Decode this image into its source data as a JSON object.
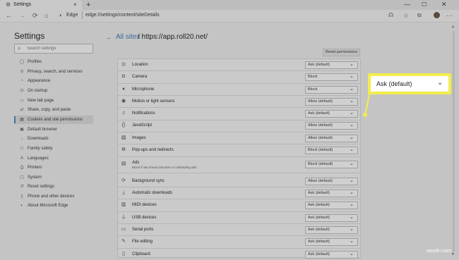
{
  "tab": {
    "title": "Settings",
    "favicon": "gear-icon",
    "new_tab": "+"
  },
  "window": {
    "minimize": "—",
    "maximize": "☐",
    "close": "✕"
  },
  "toolbar": {
    "back": "←",
    "forward": "→",
    "refresh": "C",
    "home": "⌂",
    "browser_label": "Edge",
    "url": "edge://settings/content/siteDetails"
  },
  "sidebar": {
    "title": "Settings",
    "search_placeholder": "Search settings",
    "items": [
      {
        "label": "Profiles",
        "icon": "person-icon",
        "glyph": "◯"
      },
      {
        "label": "Privacy, search, and services",
        "icon": "lock-icon",
        "glyph": "⊙"
      },
      {
        "label": "Appearance",
        "icon": "palette-icon",
        "glyph": "◔"
      },
      {
        "label": "On startup",
        "icon": "power-icon",
        "glyph": "⏻"
      },
      {
        "label": "New tab page",
        "icon": "tab-icon",
        "glyph": "▭"
      },
      {
        "label": "Share, copy, and paste",
        "icon": "share-icon",
        "glyph": "⇄"
      },
      {
        "label": "Cookies and site permissions",
        "icon": "cookie-icon",
        "glyph": "▦"
      },
      {
        "label": "Default browser",
        "icon": "browser-icon",
        "glyph": "▣"
      },
      {
        "label": "Downloads",
        "icon": "download-icon",
        "glyph": "↓"
      },
      {
        "label": "Family safety",
        "icon": "family-icon",
        "glyph": "⚇"
      },
      {
        "label": "Languages",
        "icon": "language-icon",
        "glyph": "A"
      },
      {
        "label": "Printers",
        "icon": "printer-icon",
        "glyph": "⎙"
      },
      {
        "label": "System",
        "icon": "system-icon",
        "glyph": "▢"
      },
      {
        "label": "Reset settings",
        "icon": "reset-icon",
        "glyph": "↺"
      },
      {
        "label": "Phone and other devices",
        "icon": "phone-icon",
        "glyph": "▯"
      },
      {
        "label": "About Microsoft Edge",
        "icon": "edge-icon",
        "glyph": "◐"
      }
    ],
    "active_index": 6
  },
  "main": {
    "back_arrow": "←",
    "breadcrumb_link": "All sites",
    "breadcrumb_rest": "/ https://app.roll20.net/",
    "reset_button": "Reset permissions",
    "permissions": [
      {
        "label": "Location",
        "value": "Ask (default)",
        "icon": "location-icon",
        "glyph": "◎"
      },
      {
        "label": "Camera",
        "value": "Block",
        "icon": "camera-icon",
        "glyph": "◘"
      },
      {
        "label": "Microphone",
        "value": "Block",
        "icon": "microphone-icon",
        "glyph": "♦"
      },
      {
        "label": "Motion or light sensors",
        "value": "Allow (default)",
        "icon": "sensor-icon",
        "glyph": "◉"
      },
      {
        "label": "Notifications",
        "value": "Ask (default)",
        "icon": "bell-icon",
        "glyph": "♫"
      },
      {
        "label": "JavaScript",
        "value": "Allow (default)",
        "icon": "javascript-icon",
        "glyph": "{}"
      },
      {
        "label": "Images",
        "value": "Allow (default)",
        "icon": "image-icon",
        "glyph": "▨"
      },
      {
        "label": "Pop-ups and redirects",
        "value": "Block (default)",
        "icon": "popup-icon",
        "glyph": "⧉"
      },
      {
        "label": "Ads",
        "sub": "Block if site shows intrusive or misleading ads",
        "value": "Block (default)",
        "icon": "ads-icon",
        "glyph": "▤"
      },
      {
        "label": "Background sync",
        "value": "Allow (default)",
        "icon": "sync-icon",
        "glyph": "⟳"
      },
      {
        "label": "Automatic downloads",
        "value": "Ask (default)",
        "icon": "download-icon",
        "glyph": "⤓"
      },
      {
        "label": "MIDI devices",
        "value": "Ask (default)",
        "icon": "midi-icon",
        "glyph": "▥"
      },
      {
        "label": "USB devices",
        "value": "Ask (default)",
        "icon": "usb-icon",
        "glyph": "⏚"
      },
      {
        "label": "Serial ports",
        "value": "Ask (default)",
        "icon": "serial-port-icon",
        "glyph": "▭"
      },
      {
        "label": "File editing",
        "value": "Ask (default)",
        "icon": "file-edit-icon",
        "glyph": "✎"
      },
      {
        "label": "Clipboard",
        "value": "Ask (default)",
        "icon": "clipboard-icon",
        "glyph": "▯"
      }
    ]
  },
  "callout": {
    "value": "Ask (default)",
    "chevron": "⌄",
    "border_color": "#f2ee4c"
  },
  "watermark": "wsxdn.com"
}
